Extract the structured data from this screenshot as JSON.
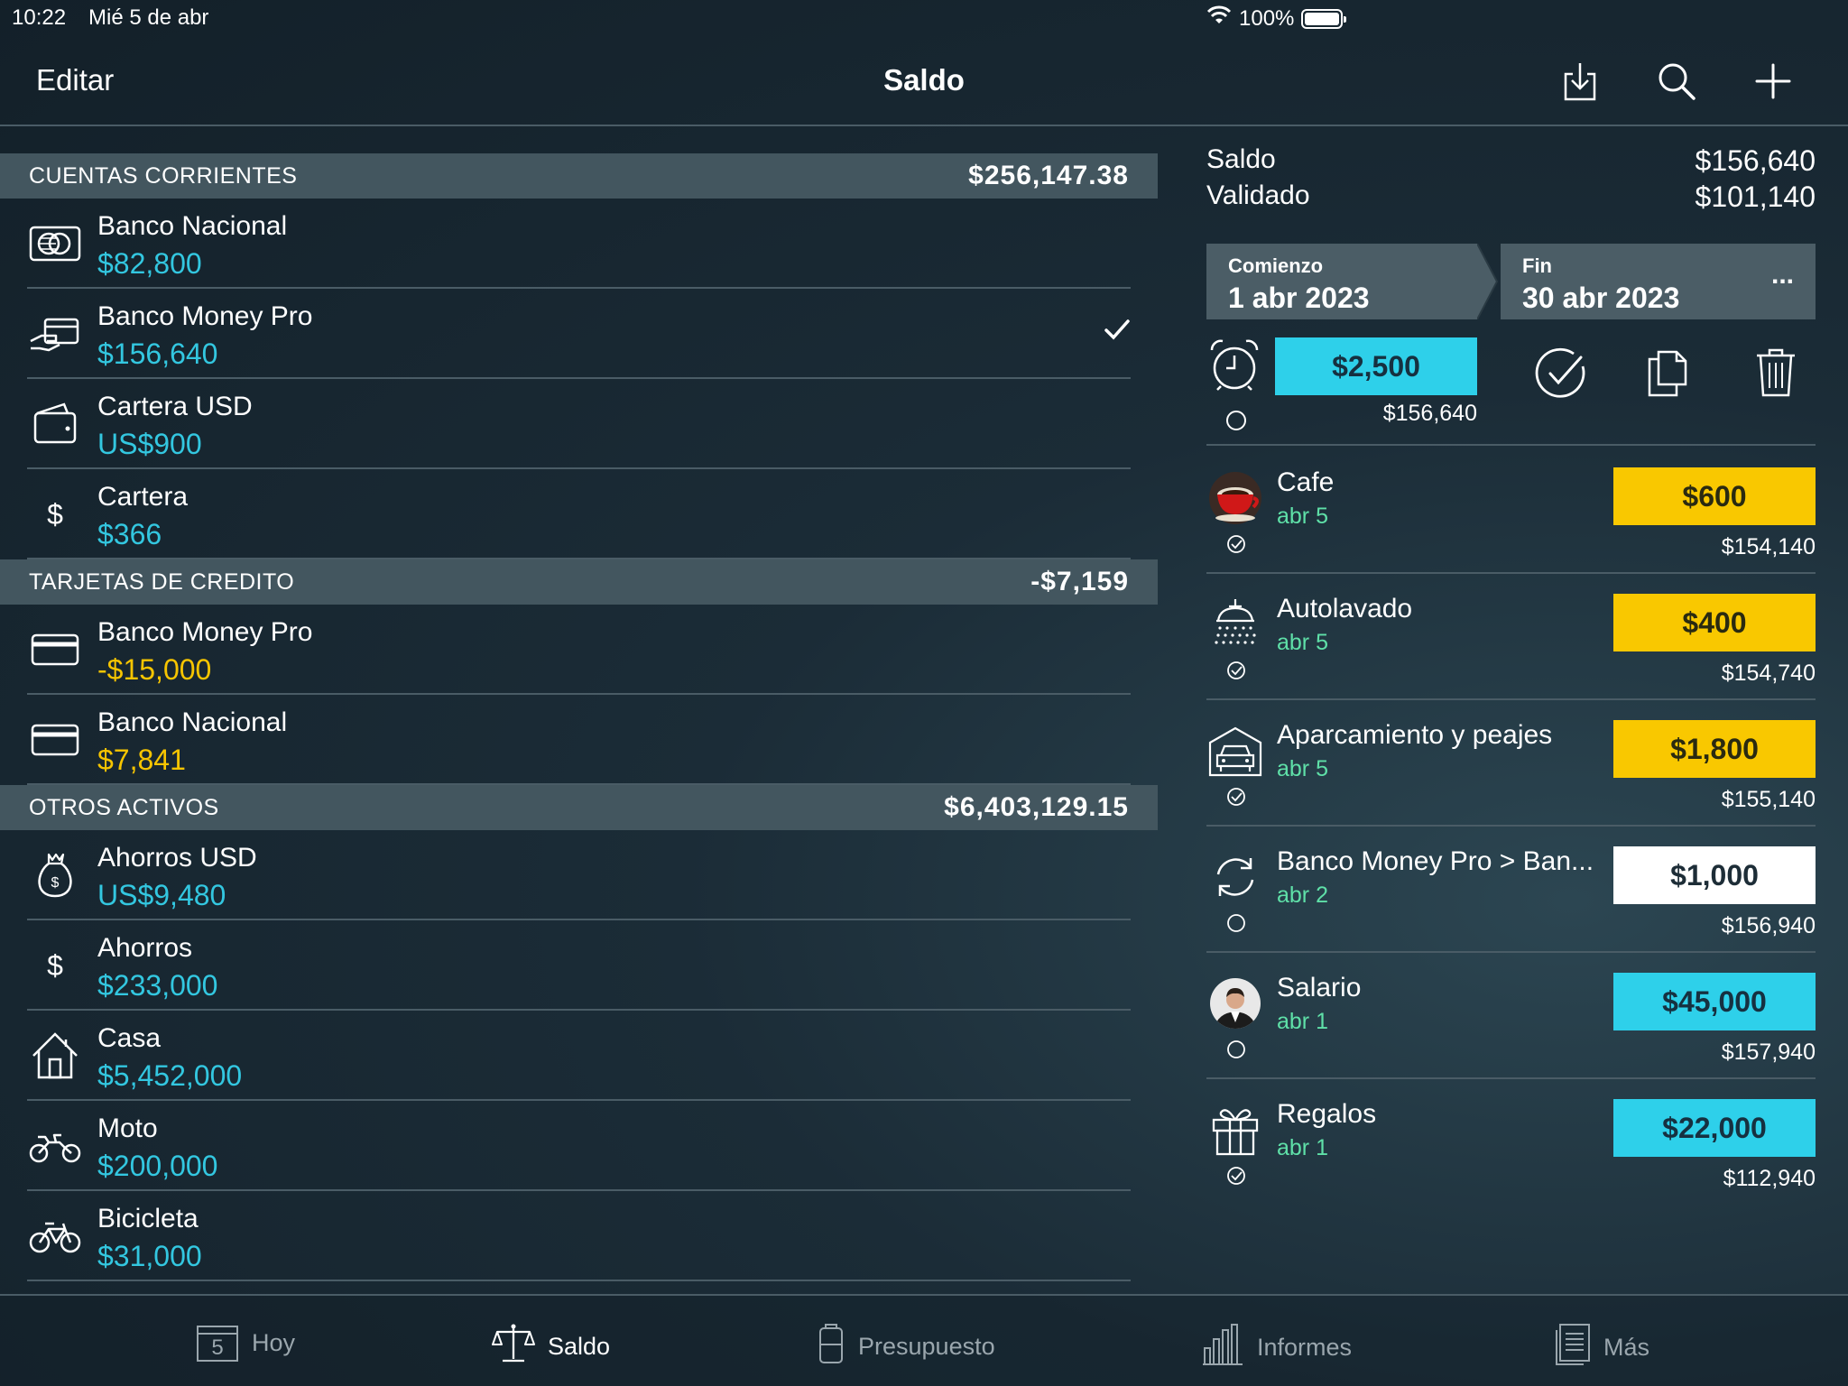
{
  "status_bar": {
    "time": "10:22",
    "date": "Mié 5 de abr",
    "battery": "100%"
  },
  "nav": {
    "edit_label": "Editar",
    "title": "Saldo"
  },
  "sections": {
    "checking": {
      "name": "CUENTAS CORRIENTES",
      "total": "$256,147.38"
    },
    "credit": {
      "name": "TARJETAS DE CREDITO",
      "total": "-$7,159"
    },
    "other": {
      "name": "OTROS ACTIVOS",
      "total": "$6,403,129.15"
    }
  },
  "accounts": [
    {
      "name": "Banco Nacional",
      "value": "$82,800",
      "icon": "bank-card-icon"
    },
    {
      "name": "Banco Money Pro",
      "value": "$156,640",
      "icon": "hand-card-icon",
      "selected": true
    },
    {
      "name": "Cartera USD",
      "value": "US$900",
      "icon": "wallet-icon"
    },
    {
      "name": "Cartera",
      "value": "$366",
      "icon": "dollar-icon"
    },
    {
      "name": "Banco Money Pro",
      "value": "-$15,000",
      "icon": "credit-card-icon"
    },
    {
      "name": "Banco Nacional",
      "value": "$7,841",
      "icon": "credit-card-icon"
    },
    {
      "name": "Ahorros USD",
      "value": "US$9,480",
      "icon": "money-bag-icon"
    },
    {
      "name": "Ahorros",
      "value": "$233,000",
      "icon": "dollar-icon"
    },
    {
      "name": "Casa",
      "value": "$5,452,000",
      "icon": "house-icon"
    },
    {
      "name": "Moto",
      "value": "$200,000",
      "icon": "motorcycle-icon"
    },
    {
      "name": "Bicicleta",
      "value": "$31,000",
      "icon": "bicycle-icon"
    }
  ],
  "summary": {
    "saldo_label": "Saldo",
    "saldo_value": "$156,640",
    "validado_label": "Validado",
    "validado_value": "$101,140"
  },
  "range": {
    "start_label": "Comienzo",
    "start_value": "1 abr 2023",
    "end_label": "Fin",
    "end_value": "30 abr 2023",
    "more": "..."
  },
  "quick": {
    "amount": "$2,500",
    "balance": "$156,640"
  },
  "transactions": [
    {
      "name": "Cafe",
      "date": "abr 5",
      "amount": "$600",
      "balance": "$154,140",
      "type": "expense",
      "validated": true,
      "icon": "coffee-cup-icon"
    },
    {
      "name": "Autolavado",
      "date": "abr 5",
      "amount": "$400",
      "balance": "$154,740",
      "type": "expense",
      "validated": true,
      "icon": "car-wash-icon"
    },
    {
      "name": "Aparcamiento y peajes",
      "date": "abr 5",
      "amount": "$1,800",
      "balance": "$155,140",
      "type": "expense",
      "validated": true,
      "icon": "garage-car-icon"
    },
    {
      "name": "Banco Money Pro > Ban...",
      "date": "abr 2",
      "amount": "$1,000",
      "balance": "$156,940",
      "type": "transfer",
      "validated": false,
      "icon": "transfer-icon"
    },
    {
      "name": "Salario",
      "date": "abr 1",
      "amount": "$45,000",
      "balance": "$157,940",
      "type": "income",
      "validated": false,
      "icon": "person-avatar-icon"
    },
    {
      "name": "Regalos",
      "date": "abr 1",
      "amount": "$22,000",
      "balance": "$112,940",
      "type": "income",
      "validated": true,
      "icon": "gift-icon"
    }
  ],
  "tabs": [
    {
      "label": "Hoy",
      "icon": "calendar-icon",
      "badge": "5"
    },
    {
      "label": "Saldo",
      "icon": "scales-icon",
      "active": true
    },
    {
      "label": "Presupuesto",
      "icon": "budget-icon"
    },
    {
      "label": "Informes",
      "icon": "bar-chart-icon"
    },
    {
      "label": "Más",
      "icon": "document-list-icon"
    }
  ],
  "colors": {
    "accent_cyan": "#33c7e0",
    "expense_yellow": "#f9c800",
    "date_green": "#5fe0a8",
    "header_bg": "#43565f"
  }
}
